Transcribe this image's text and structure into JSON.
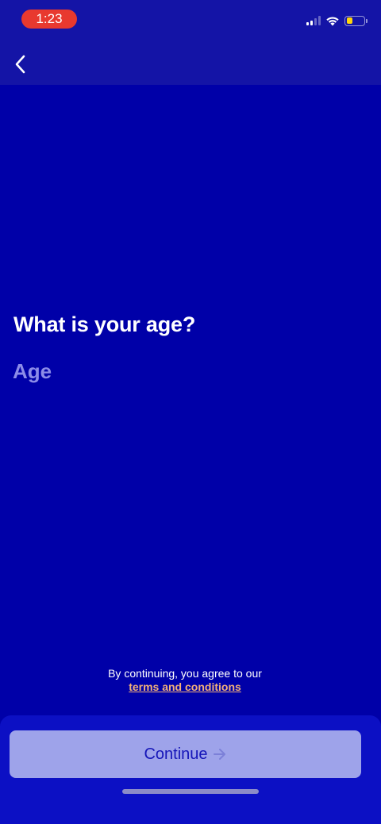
{
  "status_bar": {
    "time": "1:23",
    "battery_level_fraction": 0.3,
    "icons": [
      "signal-icon",
      "wifi-icon",
      "battery-icon"
    ]
  },
  "nav": {
    "back_icon": "chevron-left-icon"
  },
  "form": {
    "question": "What is your age?",
    "age_placeholder": "Age",
    "age_value": ""
  },
  "terms": {
    "prefix": "By continuing, you agree to our",
    "link_label": "terms and conditions"
  },
  "actions": {
    "continue_label": "Continue",
    "continue_icon": "arrow-right-icon"
  },
  "colors": {
    "background": "#0000a8",
    "header": "#1414a6",
    "time_pill": "#e8392f",
    "link": "#f2b07a",
    "button_disabled": "#9ea3ea",
    "button_text": "#1515b8"
  }
}
